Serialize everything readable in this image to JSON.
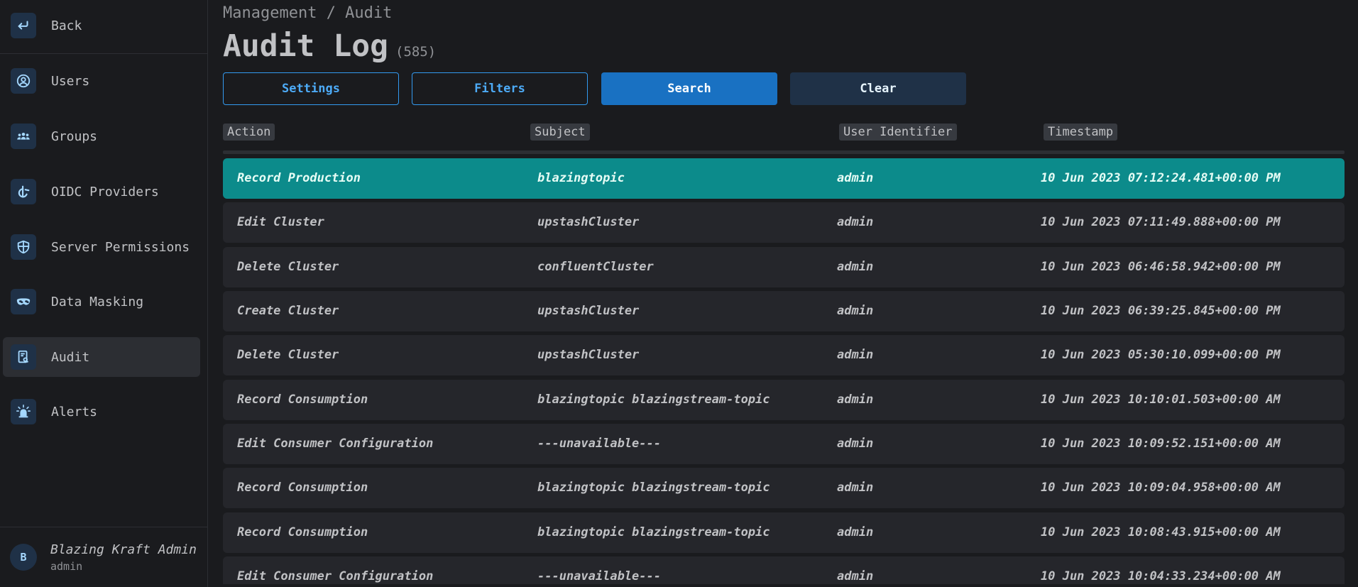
{
  "sidebar": {
    "back_label": "Back",
    "items": [
      {
        "label": "Users",
        "icon": "user-circle-icon"
      },
      {
        "label": "Groups",
        "icon": "users-group-icon"
      },
      {
        "label": "OIDC Providers",
        "icon": "oidc-icon"
      },
      {
        "label": "Server Permissions",
        "icon": "shield-icon"
      },
      {
        "label": "Data Masking",
        "icon": "mask-icon"
      },
      {
        "label": "Audit",
        "icon": "report-icon",
        "active": true
      },
      {
        "label": "Alerts",
        "icon": "alarm-icon"
      }
    ],
    "user": {
      "initial": "B",
      "name": "Blazing Kraft Admin",
      "role": "admin"
    }
  },
  "header": {
    "breadcrumb": "Management / Audit",
    "title": "Audit Log",
    "count": "(585)"
  },
  "toolbar": {
    "settings_label": "Settings",
    "filters_label": "Filters",
    "search_label": "Search",
    "clear_label": "Clear"
  },
  "table": {
    "columns": [
      "Action",
      "Subject",
      "User Identifier",
      "Timestamp"
    ],
    "rows": [
      {
        "action": "Record Production",
        "subject": "blazingtopic",
        "user": "admin",
        "timestamp": "10 Jun 2023 07:12:24.481+00:00 PM",
        "selected": true
      },
      {
        "action": "Edit Cluster",
        "subject": "upstashCluster",
        "user": "admin",
        "timestamp": "10 Jun 2023 07:11:49.888+00:00 PM"
      },
      {
        "action": "Delete Cluster",
        "subject": "confluentCluster",
        "user": "admin",
        "timestamp": "10 Jun 2023 06:46:58.942+00:00 PM"
      },
      {
        "action": "Create Cluster",
        "subject": "upstashCluster",
        "user": "admin",
        "timestamp": "10 Jun 2023 06:39:25.845+00:00 PM"
      },
      {
        "action": "Delete Cluster",
        "subject": "upstashCluster",
        "user": "admin",
        "timestamp": "10 Jun 2023 05:30:10.099+00:00 PM"
      },
      {
        "action": "Record Consumption",
        "subject": "blazingtopic blazingstream-topic",
        "user": "admin",
        "timestamp": "10 Jun 2023 10:10:01.503+00:00 AM"
      },
      {
        "action": "Edit Consumer Configuration",
        "subject": "---unavailable---",
        "user": "admin",
        "timestamp": "10 Jun 2023 10:09:52.151+00:00 AM"
      },
      {
        "action": "Record Consumption",
        "subject": "blazingtopic blazingstream-topic",
        "user": "admin",
        "timestamp": "10 Jun 2023 10:09:04.958+00:00 AM"
      },
      {
        "action": "Record Consumption",
        "subject": "blazingtopic blazingstream-topic",
        "user": "admin",
        "timestamp": "10 Jun 2023 10:08:43.915+00:00 AM"
      },
      {
        "action": "Edit Consumer Configuration",
        "subject": "---unavailable---",
        "user": "admin",
        "timestamp": "10 Jun 2023 10:04:33.234+00:00 AM"
      }
    ]
  },
  "colors": {
    "selected_row": "#0c8b8b",
    "primary": "#1971c2",
    "accent": "#339af0"
  }
}
